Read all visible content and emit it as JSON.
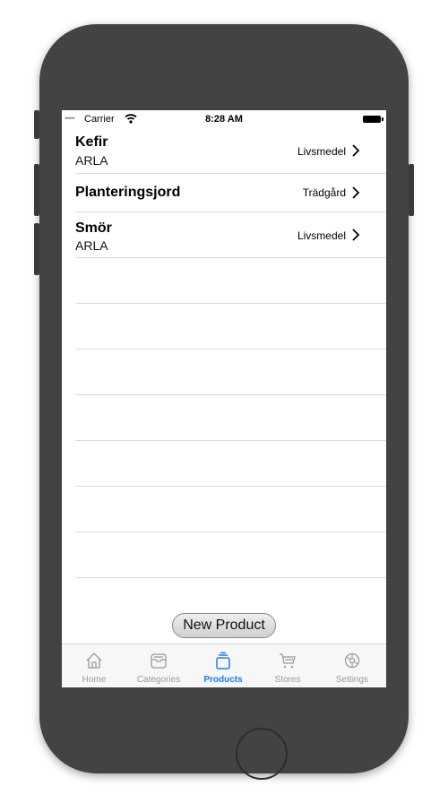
{
  "status_bar": {
    "carrier": "Carrier",
    "time": "8:28 AM"
  },
  "products": [
    {
      "name": "Kefir",
      "brand": "ARLA",
      "category": "Livsmedel"
    },
    {
      "name": "Planteringsjord",
      "brand": "",
      "category": "Trädgård"
    },
    {
      "name": "Smör",
      "brand": "ARLA",
      "category": "Livsmedel"
    }
  ],
  "new_product_label": "New Product",
  "tabs": [
    {
      "label": "Home",
      "icon": "home-icon",
      "active": false
    },
    {
      "label": "Categories",
      "icon": "tray-icon",
      "active": false
    },
    {
      "label": "Products",
      "icon": "stack-icon",
      "active": true
    },
    {
      "label": "Stores",
      "icon": "cart-icon",
      "active": false
    },
    {
      "label": "Settings",
      "icon": "gear-icon",
      "active": false
    }
  ],
  "colors": {
    "accent": "#1a7cf5",
    "inactive_tab": "#999999",
    "phone_body": "#434343"
  }
}
